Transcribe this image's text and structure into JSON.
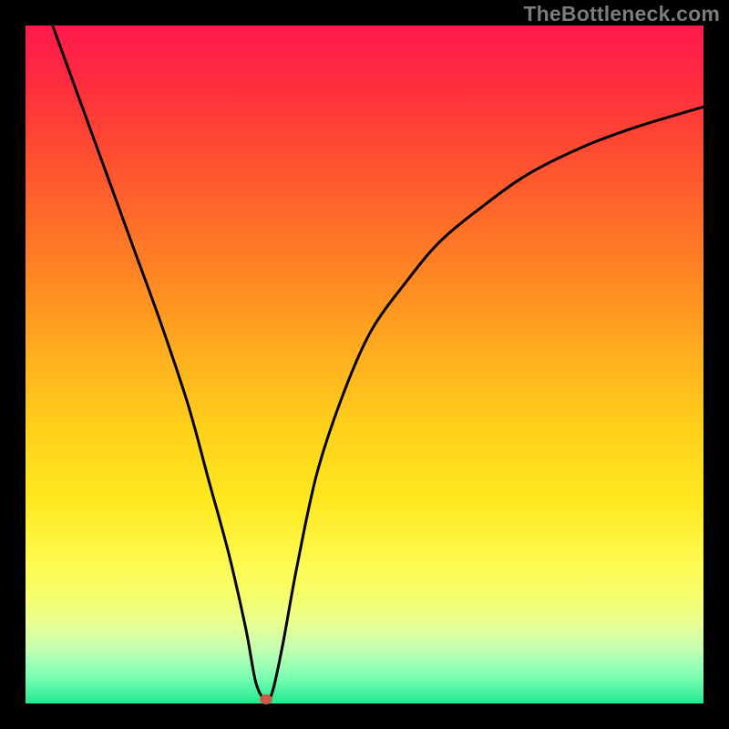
{
  "watermark": "TheBottleneck.com",
  "chart_data": {
    "type": "line",
    "title": "",
    "xlabel": "",
    "ylabel": "",
    "xlim": [
      0,
      100
    ],
    "ylim": [
      0,
      100
    ],
    "grid": false,
    "legend": false,
    "series": [
      {
        "name": "bottleneck-curve",
        "x": [
          4,
          8,
          12,
          16,
          20,
          24,
          27,
          30,
          32.5,
          34,
          35.5,
          36.5,
          38,
          40,
          43,
          47,
          51,
          56,
          61,
          67,
          74,
          82,
          90,
          100
        ],
        "values": [
          100,
          89,
          78,
          67,
          56,
          44,
          33,
          22,
          11,
          3,
          0.5,
          2,
          9,
          20,
          34,
          46,
          55,
          62,
          68,
          73,
          78,
          82,
          85,
          88
        ]
      }
    ],
    "marker": {
      "x": 35.5,
      "y": 0.5,
      "color": "#cc5a4a"
    }
  },
  "colors": {
    "frame": "#000000",
    "gradient_top": "#ff1a4d",
    "gradient_bottom": "#22e88f",
    "curve": "#000000",
    "marker": "#cc5a4a",
    "watermark": "#7b7b7b"
  }
}
